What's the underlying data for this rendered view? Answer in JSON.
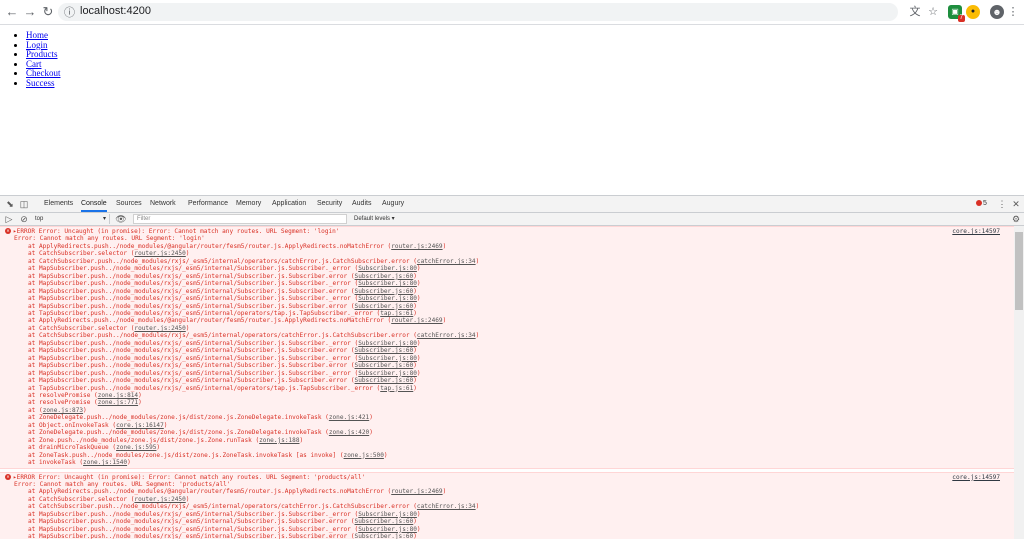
{
  "browser": {
    "url": "localhost:4200",
    "back_icon": "arrow-left",
    "forward_icon": "arrow-right",
    "reload_icon": "reload",
    "ext_badge": "7"
  },
  "page": {
    "nav_links": [
      "Home",
      "Login",
      "Products",
      "Cart",
      "Checkout",
      "Success"
    ]
  },
  "devtools": {
    "tabs": [
      "Elements",
      "Console",
      "Sources",
      "Network",
      "Performance",
      "Memory",
      "Application",
      "Security",
      "Audits",
      "Augury"
    ],
    "active_tab": "Console",
    "error_count": "5",
    "context": "top",
    "filter_placeholder": "Filter",
    "levels": "Default levels ▾"
  },
  "console": {
    "errors": [
      {
        "header": "ERROR Error: Uncaught (in promise): Error: Cannot match any routes. URL Segment: 'login'",
        "source": "core.js:14597",
        "message": "Error: Cannot match any routes. URL Segment: 'login'",
        "frames": [
          {
            "text": "at ApplyRedirects.push../node_modules/@angular/router/fesm5/router.js.ApplyRedirects.noMatchError",
            "link": "router.js:2469"
          },
          {
            "text": "at CatchSubscriber.selector",
            "link": "router.js:2450"
          },
          {
            "text": "at CatchSubscriber.push../node_modules/rxjs/_esm5/internal/operators/catchError.js.CatchSubscriber.error",
            "link": "catchError.js:34"
          },
          {
            "text": "at MapSubscriber.push../node_modules/rxjs/_esm5/internal/Subscriber.js.Subscriber._error",
            "link": "Subscriber.js:80"
          },
          {
            "text": "at MapSubscriber.push../node_modules/rxjs/_esm5/internal/Subscriber.js.Subscriber.error",
            "link": "Subscriber.js:60"
          },
          {
            "text": "at MapSubscriber.push../node_modules/rxjs/_esm5/internal/Subscriber.js.Subscriber._error",
            "link": "Subscriber.js:80"
          },
          {
            "text": "at MapSubscriber.push../node_modules/rxjs/_esm5/internal/Subscriber.js.Subscriber.error",
            "link": "Subscriber.js:60"
          },
          {
            "text": "at MapSubscriber.push../node_modules/rxjs/_esm5/internal/Subscriber.js.Subscriber._error",
            "link": "Subscriber.js:80"
          },
          {
            "text": "at MapSubscriber.push../node_modules/rxjs/_esm5/internal/Subscriber.js.Subscriber.error",
            "link": "Subscriber.js:60"
          },
          {
            "text": "at TapSubscriber.push../node_modules/rxjs/_esm5/internal/operators/tap.js.TapSubscriber._error",
            "link": "tap.js:61"
          },
          {
            "text": "at ApplyRedirects.push../node_modules/@angular/router/fesm5/router.js.ApplyRedirects.noMatchError",
            "link": "router.js:2469"
          },
          {
            "text": "at CatchSubscriber.selector",
            "link": "router.js:2450"
          },
          {
            "text": "at CatchSubscriber.push../node_modules/rxjs/_esm5/internal/operators/catchError.js.CatchSubscriber.error",
            "link": "catchError.js:34"
          },
          {
            "text": "at MapSubscriber.push../node_modules/rxjs/_esm5/internal/Subscriber.js.Subscriber._error",
            "link": "Subscriber.js:80"
          },
          {
            "text": "at MapSubscriber.push../node_modules/rxjs/_esm5/internal/Subscriber.js.Subscriber.error",
            "link": "Subscriber.js:60"
          },
          {
            "text": "at MapSubscriber.push../node_modules/rxjs/_esm5/internal/Subscriber.js.Subscriber._error",
            "link": "Subscriber.js:80"
          },
          {
            "text": "at MapSubscriber.push../node_modules/rxjs/_esm5/internal/Subscriber.js.Subscriber.error",
            "link": "Subscriber.js:60"
          },
          {
            "text": "at MapSubscriber.push../node_modules/rxjs/_esm5/internal/Subscriber.js.Subscriber._error",
            "link": "Subscriber.js:80"
          },
          {
            "text": "at MapSubscriber.push../node_modules/rxjs/_esm5/internal/Subscriber.js.Subscriber.error",
            "link": "Subscriber.js:60"
          },
          {
            "text": "at TapSubscriber.push../node_modules/rxjs/_esm5/internal/operators/tap.js.TapSubscriber._error",
            "link": "tap.js:61"
          },
          {
            "text": "at resolvePromise",
            "link": "zone.js:814"
          },
          {
            "text": "at resolvePromise",
            "link": "zone.js:771"
          },
          {
            "text": "at",
            "link": "zone.js:873"
          },
          {
            "text": "at ZoneDelegate.push../node_modules/zone.js/dist/zone.js.ZoneDelegate.invokeTask",
            "link": "zone.js:421"
          },
          {
            "text": "at Object.onInvokeTask",
            "link": "core.js:16147"
          },
          {
            "text": "at ZoneDelegate.push../node_modules/zone.js/dist/zone.js.ZoneDelegate.invokeTask",
            "link": "zone.js:420"
          },
          {
            "text": "at Zone.push../node_modules/zone.js/dist/zone.js.Zone.runTask",
            "link": "zone.js:188"
          },
          {
            "text": "at drainMicroTaskQueue",
            "link": "zone.js:595"
          },
          {
            "text": "at ZoneTask.push../node_modules/zone.js/dist/zone.js.ZoneTask.invokeTask [as invoke]",
            "link": "zone.js:500"
          },
          {
            "text": "at invokeTask",
            "link": "zone.js:1540"
          }
        ]
      },
      {
        "header": "ERROR Error: Uncaught (in promise): Error: Cannot match any routes. URL Segment: 'products/all'",
        "source": "core.js:14597",
        "message": "Error: Cannot match any routes. URL Segment: 'products/all'",
        "frames": [
          {
            "text": "at ApplyRedirects.push../node_modules/@angular/router/fesm5/router.js.ApplyRedirects.noMatchError",
            "link": "router.js:2469"
          },
          {
            "text": "at CatchSubscriber.selector",
            "link": "router.js:2450"
          },
          {
            "text": "at CatchSubscriber.push../node_modules/rxjs/_esm5/internal/operators/catchError.js.CatchSubscriber.error",
            "link": "catchError.js:34"
          },
          {
            "text": "at MapSubscriber.push../node_modules/rxjs/_esm5/internal/Subscriber.js.Subscriber._error",
            "link": "Subscriber.js:80"
          },
          {
            "text": "at MapSubscriber.push../node_modules/rxjs/_esm5/internal/Subscriber.js.Subscriber.error",
            "link": "Subscriber.js:60"
          },
          {
            "text": "at MapSubscriber.push../node_modules/rxjs/_esm5/internal/Subscriber.js.Subscriber._error",
            "link": "Subscriber.js:80"
          },
          {
            "text": "at MapSubscriber.push../node_modules/rxjs/_esm5/internal/Subscriber.js.Subscriber.error",
            "link": "Subscriber.js:60"
          },
          {
            "text": "at MapSubscriber.push../node_modules/rxjs/_esm5/internal/Subscriber.js.Subscriber._error",
            "link": "Subscriber.js:80"
          },
          {
            "text": "at MapSubscriber.push../node_modules/rxjs/_esm5/internal/Subscriber.js.Subscriber.error",
            "link": "Subscriber.js:60"
          }
        ]
      }
    ]
  }
}
